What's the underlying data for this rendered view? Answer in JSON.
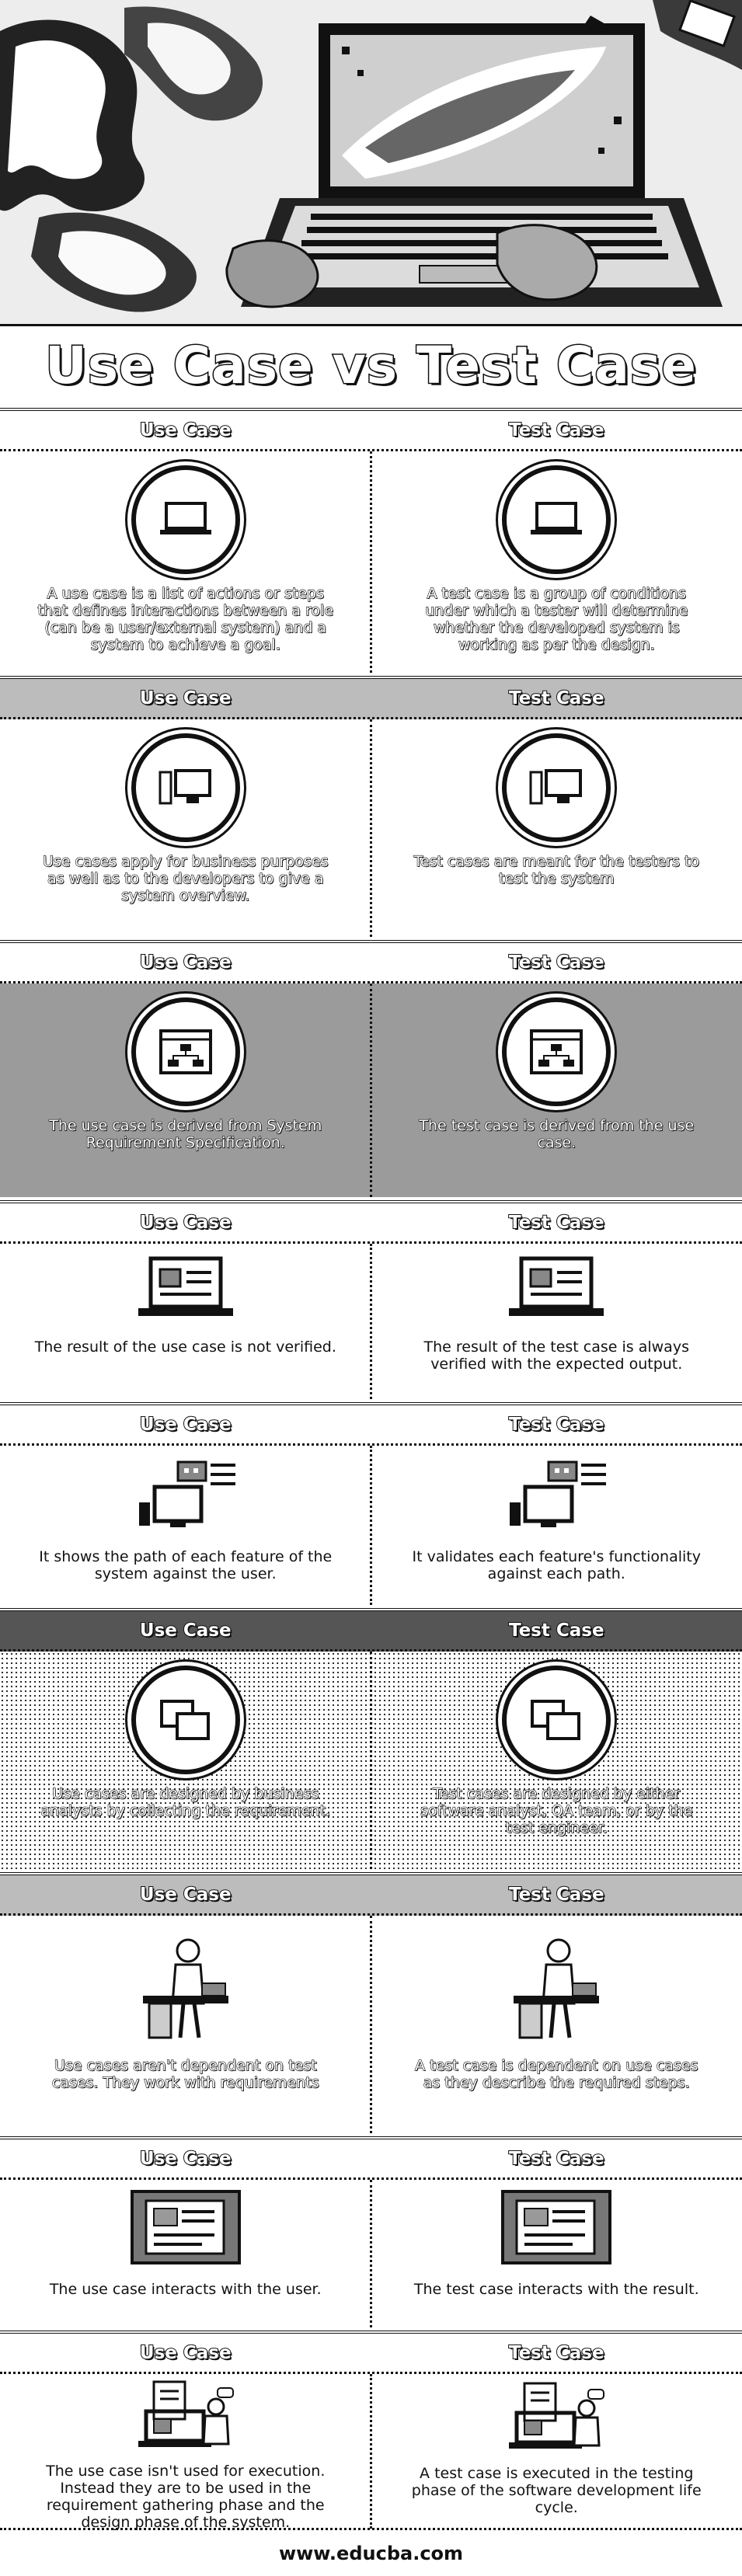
{
  "title": "Use Case vs Test Case",
  "sections": [
    {
      "left_label": "Use Case",
      "right_label": "Test Case",
      "left_text": "A use case is a list of actions or steps that defines interactions between a role (can be a user/external system) and a system to achieve a goal.",
      "right_text": "A test case is a group of conditions under which a tester will determine whether the developed system is working as per the design.",
      "icon": "laptop-icon"
    },
    {
      "left_label": "Use Case",
      "right_label": "Test Case",
      "left_text": "Use cases apply for business purposes as well as to the developers to give a system overview.",
      "right_text": "Test cases are meant for the testers to test the system",
      "icon": "desktop-computer-icon"
    },
    {
      "left_label": "Use Case",
      "right_label": "Test Case",
      "left_text": "The use case is derived from System Requirement Specification.",
      "right_text": "The test case is derived from the use case.",
      "icon": "sitemap-window-icon"
    },
    {
      "left_label": "Use Case",
      "right_label": "Test Case",
      "left_text": "The result of the use case is not verified.",
      "right_text": "The result of the test case is always verified with the expected output.",
      "icon": "laptop-document-icon"
    },
    {
      "left_label": "Use Case",
      "right_label": "Test Case",
      "left_text": "It shows the path of each feature of the system against the user.",
      "right_text": "It validates each feature's functionality against each path.",
      "icon": "monitor-chat-icon"
    },
    {
      "left_label": "Use Case",
      "right_label": "Test Case",
      "left_text": "Use cases are designed by business analysts by collecting the requirement.",
      "right_text": "Test cases are designed by either software analyst, QA team, or by the test engineer.",
      "icon": "dual-window-icon"
    },
    {
      "left_label": "Use Case",
      "right_label": "Test Case",
      "left_text": "Use cases aren't dependent on test cases. They work with requirements",
      "right_text": "A test case is dependent on use cases as they describe the required steps.",
      "icon": "person-at-desk-icon"
    },
    {
      "left_label": "Use Case",
      "right_label": "Test Case",
      "left_text": "The use case interacts with the user.",
      "right_text": "The test case interacts with the result.",
      "icon": "tablet-workspace-icon"
    },
    {
      "left_label": "Use Case",
      "right_label": "Test Case",
      "left_text": "The use case isn't used for execution. Instead they are to be used in the requirement gathering phase and the design phase of the system.",
      "right_text": "A test case is executed in the testing phase of the software development life cycle.",
      "icon": "laptop-person-icon"
    }
  ],
  "footer": "www.educba.com"
}
